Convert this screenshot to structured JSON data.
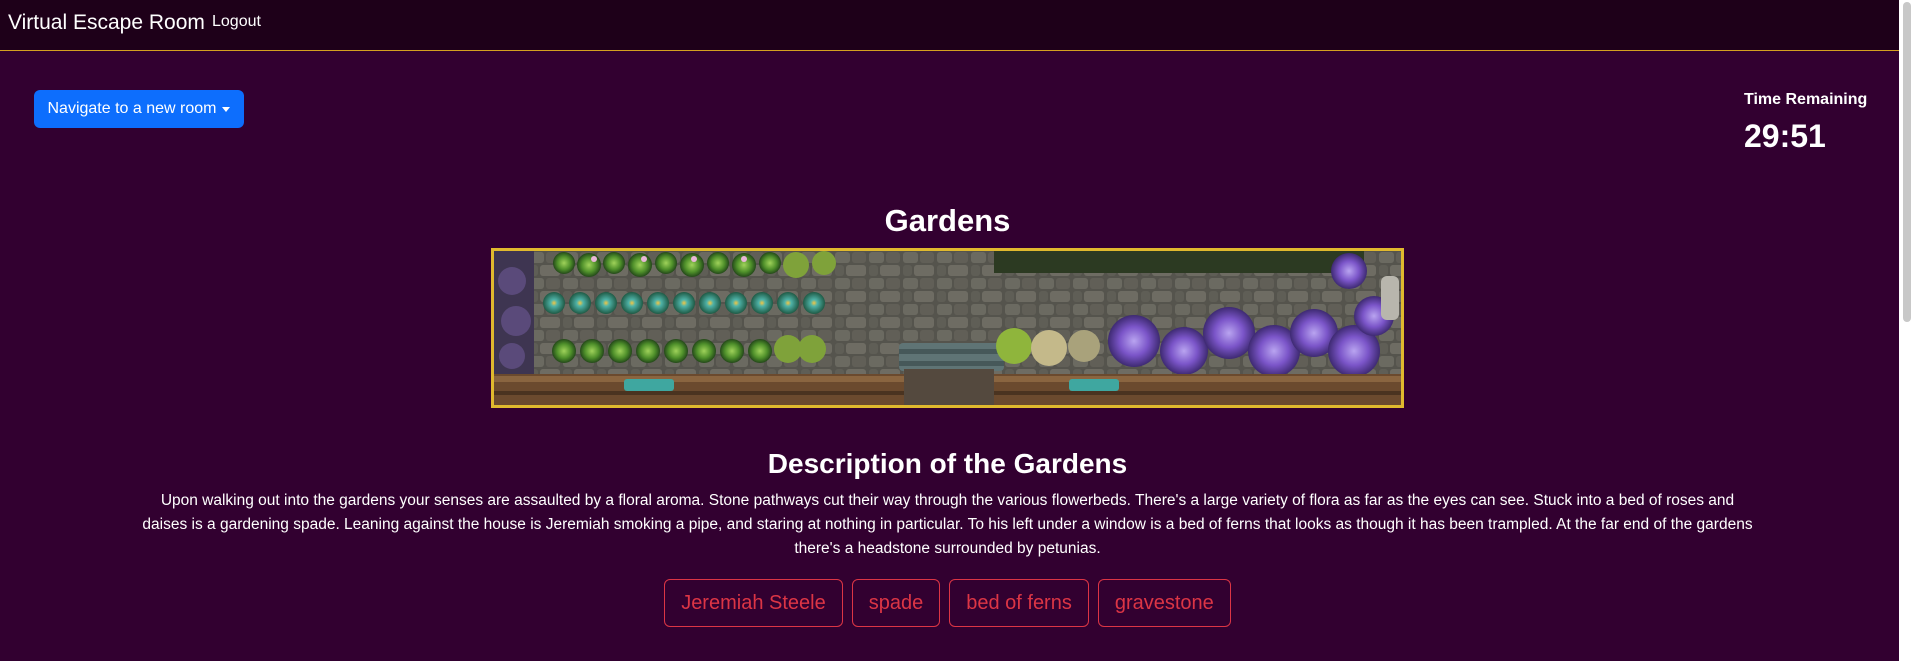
{
  "navbar": {
    "brand": "Virtual Escape Room",
    "logout": "Logout"
  },
  "dropdown": {
    "label": "Navigate to a new room"
  },
  "timer": {
    "label": "Time Remaining",
    "value": "29:51"
  },
  "room": {
    "title": "Gardens",
    "description_title": "Description of the Gardens",
    "description": "Upon walking out into the gardens your senses are assaulted by a floral aroma. Stone pathways cut their way through the various flowerbeds. There's a large variety of flora as far as the eyes can see. Stuck into a bed of roses and daises is a gardening spade. Leaning against the house is Jeremiah smoking a pipe, and staring at nothing in particular. To his left under a window is a bed of ferns that looks as though it has been trampled. At the far end of the gardens there's a headstone surrounded by petunias."
  },
  "items": [
    {
      "label": "Jeremiah Steele"
    },
    {
      "label": "spade"
    },
    {
      "label": "bed of ferns"
    },
    {
      "label": "gravestone"
    }
  ],
  "colors": {
    "background": "#320030",
    "navbar": "#1e0019",
    "accent_border": "#e0b92e",
    "primary_button": "#0d6efd",
    "item_outline": "#dc3545"
  }
}
